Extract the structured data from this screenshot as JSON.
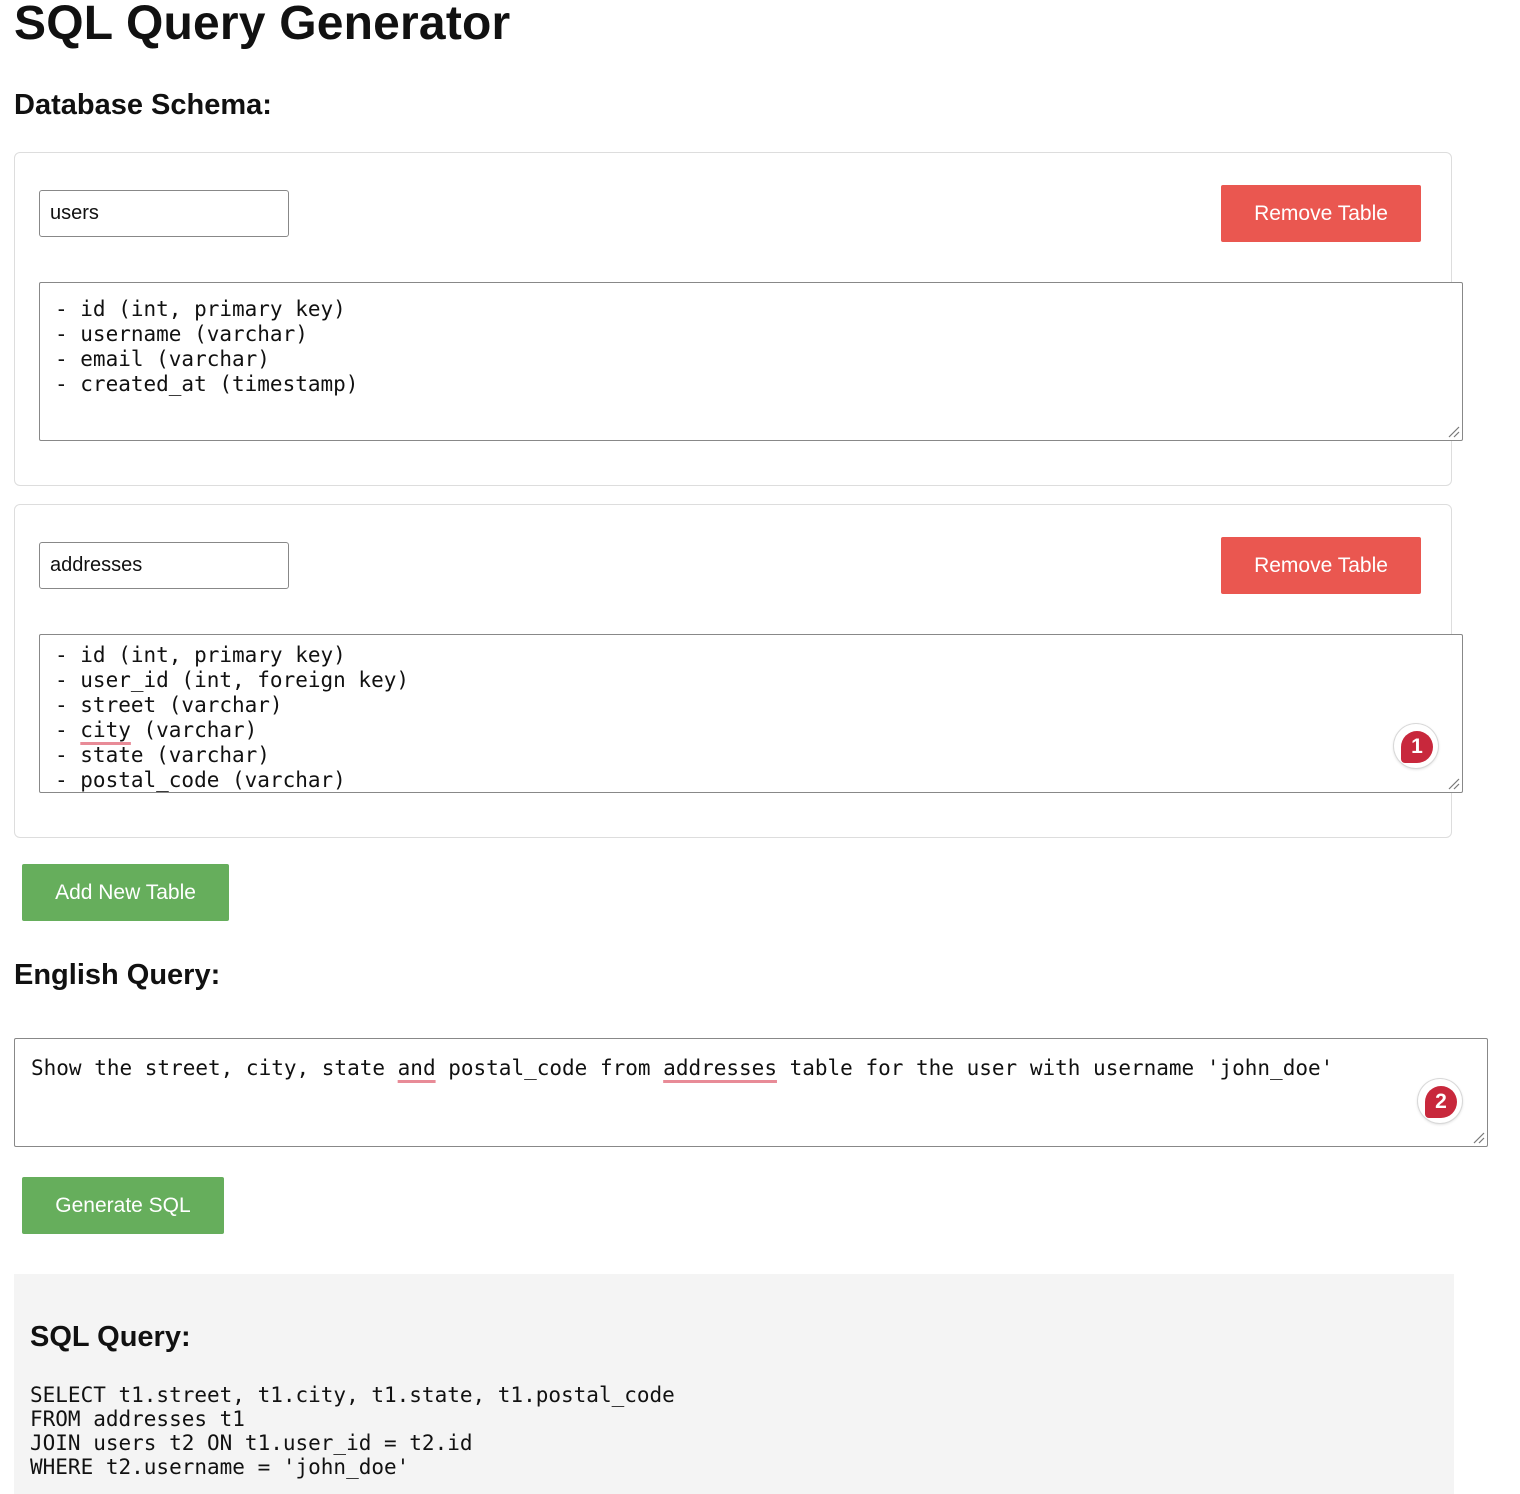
{
  "title": "SQL Query Generator",
  "schema": {
    "heading": "Database Schema:",
    "tables": [
      {
        "name": "users",
        "remove_label": "Remove Table",
        "columns": "- id (int, primary key)\n- username (varchar)\n- email (varchar)\n- created_at (timestamp)"
      },
      {
        "name": "addresses",
        "remove_label": "Remove Table",
        "columns_lines": [
          "- id (int, primary key)",
          "- user_id (int, foreign key)",
          "- street (varchar)",
          "- ",
          "- state (varchar)",
          "- postal_code (varchar)"
        ],
        "misspelled_word": "city",
        "line4_rest": " (varchar)",
        "badge": "1"
      }
    ],
    "add_label": "Add New Table"
  },
  "english": {
    "heading": "English Query:",
    "text_parts": [
      "Show the street, city, state ",
      "and",
      " postal_code from ",
      "addresses",
      " table for the user with username 'john_doe'"
    ],
    "badge": "2",
    "generate_label": "Generate SQL"
  },
  "result": {
    "heading": "SQL Query:",
    "sql": "SELECT t1.street, t1.city, t1.state, t1.postal_code\nFROM addresses t1\nJOIN users t2 ON t1.user_id = t2.id\nWHERE t2.username = 'john_doe'"
  },
  "colors": {
    "remove_button": "#ea5750",
    "green_button": "#66ae5c",
    "badge": "#c8283c",
    "result_bg": "#f4f4f4"
  }
}
